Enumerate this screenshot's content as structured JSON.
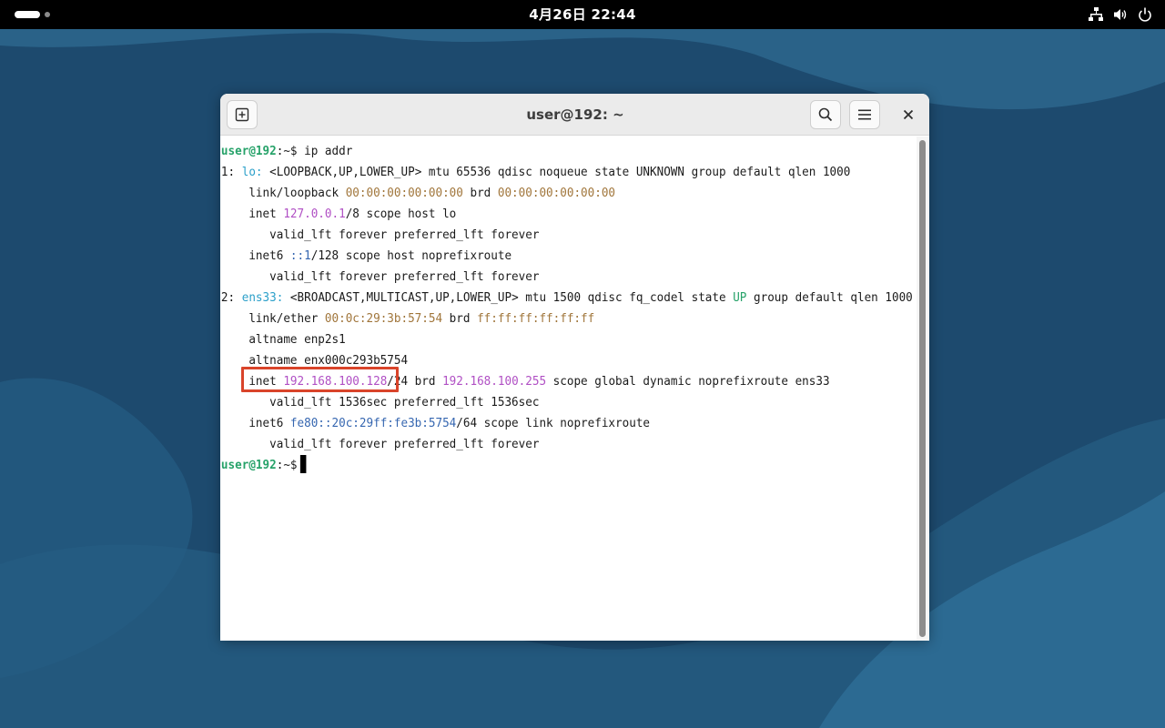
{
  "topbar": {
    "clock": "4月26日  22:44",
    "tray_icons": [
      "network-icon",
      "volume-icon",
      "power-icon"
    ]
  },
  "window": {
    "title": "user@192: ~"
  },
  "terminal": {
    "lines": [
      [
        {
          "t": "user@192",
          "c": "prompt"
        },
        {
          "t": ":~$ ip addr"
        }
      ],
      [
        {
          "t": "1: "
        },
        {
          "t": "lo:",
          "c": "iface"
        },
        {
          "t": " <LOOPBACK,UP,LOWER_UP> mtu 65536 qdisc noqueue state UNKNOWN group default qlen 1000"
        }
      ],
      [
        {
          "t": "    link/loopback "
        },
        {
          "t": "00:00:00:00:00:00",
          "c": "mac"
        },
        {
          "t": " brd "
        },
        {
          "t": "00:00:00:00:00:00",
          "c": "mac"
        }
      ],
      [
        {
          "t": "    inet "
        },
        {
          "t": "127.0.0.1",
          "c": "ip"
        },
        {
          "t": "/8 scope host lo"
        }
      ],
      [
        {
          "t": "       valid_lft forever preferred_lft forever"
        }
      ],
      [
        {
          "t": "    inet6 "
        },
        {
          "t": "::1",
          "c": "ip6"
        },
        {
          "t": "/128 scope host noprefixroute"
        }
      ],
      [
        {
          "t": "       valid_lft forever preferred_lft forever"
        }
      ],
      [
        {
          "t": "2: "
        },
        {
          "t": "ens33:",
          "c": "iface"
        },
        {
          "t": " <BROADCAST,MULTICAST,UP,LOWER_UP> mtu 1500 qdisc fq_codel state "
        },
        {
          "t": "UP",
          "c": "up"
        },
        {
          "t": " group default qlen 1000"
        }
      ],
      [
        {
          "t": "    link/ether "
        },
        {
          "t": "00:0c:29:3b:57:54",
          "c": "mac"
        },
        {
          "t": " brd "
        },
        {
          "t": "ff:ff:ff:ff:ff:ff",
          "c": "mac"
        }
      ],
      [
        {
          "t": "    altname enp2s1"
        }
      ],
      [
        {
          "t": "    altname enx000c293b5754"
        }
      ],
      [
        {
          "t": "    inet "
        },
        {
          "t": "192.168.100.128",
          "c": "ip"
        },
        {
          "t": "/24 brd "
        },
        {
          "t": "192.168.100.255",
          "c": "ip"
        },
        {
          "t": " scope global dynamic noprefixroute ens33"
        }
      ],
      [
        {
          "t": "       valid_lft 1536sec preferred_lft 1536sec"
        }
      ],
      [
        {
          "t": "    inet6 "
        },
        {
          "t": "fe80::20c:29ff:fe3b:5754",
          "c": "ip6"
        },
        {
          "t": "/64 scope link noprefixroute"
        }
      ],
      [
        {
          "t": "       valid_lft forever preferred_lft forever"
        }
      ],
      [
        {
          "t": "user@192",
          "c": "prompt"
        },
        {
          "t": ":~$"
        }
      ]
    ],
    "colors": {
      "prompt": "#26a269",
      "iface": "#2a9fc9",
      "mac": "#a0753a",
      "ip": "#b04fc4",
      "ip6": "#3566b0",
      "up": "#26a269",
      "highlight": "#d9442a"
    }
  }
}
